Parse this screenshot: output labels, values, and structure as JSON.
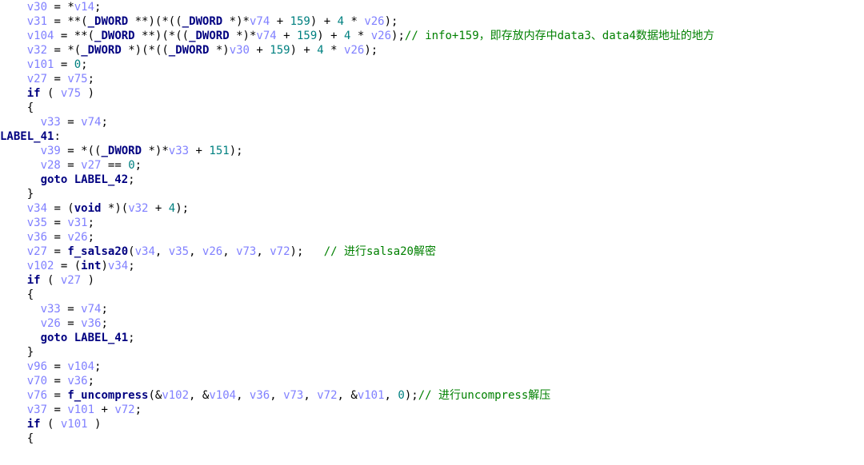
{
  "code": [
    {
      "indent": 2,
      "segs": [
        {
          "t": "var",
          "s": "v30"
        },
        {
          "t": "plain",
          "s": " = "
        },
        {
          "t": "op",
          "s": "*"
        },
        {
          "t": "var",
          "s": "v14"
        },
        {
          "t": "plain",
          "s": ";"
        }
      ]
    },
    {
      "indent": 2,
      "segs": [
        {
          "t": "var",
          "s": "v31"
        },
        {
          "t": "plain",
          "s": " = "
        },
        {
          "t": "op",
          "s": "**"
        },
        {
          "t": "plain",
          "s": "("
        },
        {
          "t": "kw",
          "s": "_DWORD"
        },
        {
          "t": "plain",
          "s": " "
        },
        {
          "t": "op",
          "s": "**"
        },
        {
          "t": "plain",
          "s": ")("
        },
        {
          "t": "op",
          "s": "*"
        },
        {
          "t": "plain",
          "s": "(("
        },
        {
          "t": "kw",
          "s": "_DWORD"
        },
        {
          "t": "plain",
          "s": " "
        },
        {
          "t": "op",
          "s": "*"
        },
        {
          "t": "plain",
          "s": ")"
        },
        {
          "t": "op",
          "s": "*"
        },
        {
          "t": "var",
          "s": "v74"
        },
        {
          "t": "plain",
          "s": " + "
        },
        {
          "t": "num",
          "s": "159"
        },
        {
          "t": "plain",
          "s": ") + "
        },
        {
          "t": "num",
          "s": "4"
        },
        {
          "t": "plain",
          "s": " "
        },
        {
          "t": "op",
          "s": "*"
        },
        {
          "t": "plain",
          "s": " "
        },
        {
          "t": "var",
          "s": "v26"
        },
        {
          "t": "plain",
          "s": ");"
        }
      ]
    },
    {
      "indent": 2,
      "segs": [
        {
          "t": "var",
          "s": "v104"
        },
        {
          "t": "plain",
          "s": " = "
        },
        {
          "t": "op",
          "s": "**"
        },
        {
          "t": "plain",
          "s": "("
        },
        {
          "t": "kw",
          "s": "_DWORD"
        },
        {
          "t": "plain",
          "s": " "
        },
        {
          "t": "op",
          "s": "**"
        },
        {
          "t": "plain",
          "s": ")("
        },
        {
          "t": "op",
          "s": "*"
        },
        {
          "t": "plain",
          "s": "(("
        },
        {
          "t": "kw",
          "s": "_DWORD"
        },
        {
          "t": "plain",
          "s": " "
        },
        {
          "t": "op",
          "s": "*"
        },
        {
          "t": "plain",
          "s": ")"
        },
        {
          "t": "op",
          "s": "*"
        },
        {
          "t": "var",
          "s": "v74"
        },
        {
          "t": "plain",
          "s": " + "
        },
        {
          "t": "num",
          "s": "159"
        },
        {
          "t": "plain",
          "s": ") + "
        },
        {
          "t": "num",
          "s": "4"
        },
        {
          "t": "plain",
          "s": " "
        },
        {
          "t": "op",
          "s": "*"
        },
        {
          "t": "plain",
          "s": " "
        },
        {
          "t": "var",
          "s": "v26"
        },
        {
          "t": "plain",
          "s": ");"
        },
        {
          "t": "cmt",
          "s": "// info+159，即存放内存中data3、data4数据地址的地方"
        }
      ]
    },
    {
      "indent": 2,
      "segs": [
        {
          "t": "var",
          "s": "v32"
        },
        {
          "t": "plain",
          "s": " = "
        },
        {
          "t": "op",
          "s": "*"
        },
        {
          "t": "plain",
          "s": "("
        },
        {
          "t": "kw",
          "s": "_DWORD"
        },
        {
          "t": "plain",
          "s": " "
        },
        {
          "t": "op",
          "s": "*"
        },
        {
          "t": "plain",
          "s": ")("
        },
        {
          "t": "op",
          "s": "*"
        },
        {
          "t": "plain",
          "s": "(("
        },
        {
          "t": "kw",
          "s": "_DWORD"
        },
        {
          "t": "plain",
          "s": " "
        },
        {
          "t": "op",
          "s": "*"
        },
        {
          "t": "plain",
          "s": ")"
        },
        {
          "t": "var",
          "s": "v30"
        },
        {
          "t": "plain",
          "s": " + "
        },
        {
          "t": "num",
          "s": "159"
        },
        {
          "t": "plain",
          "s": ") + "
        },
        {
          "t": "num",
          "s": "4"
        },
        {
          "t": "plain",
          "s": " "
        },
        {
          "t": "op",
          "s": "*"
        },
        {
          "t": "plain",
          "s": " "
        },
        {
          "t": "var",
          "s": "v26"
        },
        {
          "t": "plain",
          "s": ");"
        }
      ]
    },
    {
      "indent": 2,
      "segs": [
        {
          "t": "var",
          "s": "v101"
        },
        {
          "t": "plain",
          "s": " = "
        },
        {
          "t": "num",
          "s": "0"
        },
        {
          "t": "plain",
          "s": ";"
        }
      ]
    },
    {
      "indent": 2,
      "segs": [
        {
          "t": "var",
          "s": "v27"
        },
        {
          "t": "plain",
          "s": " = "
        },
        {
          "t": "var",
          "s": "v75"
        },
        {
          "t": "plain",
          "s": ";"
        }
      ]
    },
    {
      "indent": 2,
      "segs": [
        {
          "t": "kw",
          "s": "if"
        },
        {
          "t": "plain",
          "s": " ( "
        },
        {
          "t": "var",
          "s": "v75"
        },
        {
          "t": "plain",
          "s": " )"
        }
      ]
    },
    {
      "indent": 2,
      "segs": [
        {
          "t": "plain",
          "s": "{"
        }
      ]
    },
    {
      "indent": 3,
      "segs": [
        {
          "t": "var",
          "s": "v33"
        },
        {
          "t": "plain",
          "s": " = "
        },
        {
          "t": "var",
          "s": "v74"
        },
        {
          "t": "plain",
          "s": ";"
        }
      ]
    },
    {
      "indent": 0,
      "segs": [
        {
          "t": "kw",
          "s": "LABEL_41"
        },
        {
          "t": "plain",
          "s": ":"
        }
      ]
    },
    {
      "indent": 3,
      "segs": [
        {
          "t": "var",
          "s": "v39"
        },
        {
          "t": "plain",
          "s": " = "
        },
        {
          "t": "op",
          "s": "*"
        },
        {
          "t": "plain",
          "s": "(("
        },
        {
          "t": "kw",
          "s": "_DWORD"
        },
        {
          "t": "plain",
          "s": " "
        },
        {
          "t": "op",
          "s": "*"
        },
        {
          "t": "plain",
          "s": ")"
        },
        {
          "t": "op",
          "s": "*"
        },
        {
          "t": "var",
          "s": "v33"
        },
        {
          "t": "plain",
          "s": " + "
        },
        {
          "t": "num",
          "s": "151"
        },
        {
          "t": "plain",
          "s": ");"
        }
      ]
    },
    {
      "indent": 3,
      "segs": [
        {
          "t": "var",
          "s": "v28"
        },
        {
          "t": "plain",
          "s": " = "
        },
        {
          "t": "var",
          "s": "v27"
        },
        {
          "t": "plain",
          "s": " == "
        },
        {
          "t": "num",
          "s": "0"
        },
        {
          "t": "plain",
          "s": ";"
        }
      ]
    },
    {
      "indent": 3,
      "segs": [
        {
          "t": "kw",
          "s": "goto"
        },
        {
          "t": "plain",
          "s": " "
        },
        {
          "t": "kw",
          "s": "LABEL_42"
        },
        {
          "t": "plain",
          "s": ";"
        }
      ]
    },
    {
      "indent": 2,
      "segs": [
        {
          "t": "plain",
          "s": "}"
        }
      ]
    },
    {
      "indent": 2,
      "segs": [
        {
          "t": "var",
          "s": "v34"
        },
        {
          "t": "plain",
          "s": " = ("
        },
        {
          "t": "kw",
          "s": "void"
        },
        {
          "t": "plain",
          "s": " "
        },
        {
          "t": "op",
          "s": "*"
        },
        {
          "t": "plain",
          "s": ")("
        },
        {
          "t": "var",
          "s": "v32"
        },
        {
          "t": "plain",
          "s": " + "
        },
        {
          "t": "num",
          "s": "4"
        },
        {
          "t": "plain",
          "s": ");"
        }
      ]
    },
    {
      "indent": 2,
      "segs": [
        {
          "t": "var",
          "s": "v35"
        },
        {
          "t": "plain",
          "s": " = "
        },
        {
          "t": "var",
          "s": "v31"
        },
        {
          "t": "plain",
          "s": ";"
        }
      ]
    },
    {
      "indent": 2,
      "segs": [
        {
          "t": "var",
          "s": "v36"
        },
        {
          "t": "plain",
          "s": " = "
        },
        {
          "t": "var",
          "s": "v26"
        },
        {
          "t": "plain",
          "s": ";"
        }
      ]
    },
    {
      "indent": 2,
      "segs": [
        {
          "t": "var",
          "s": "v27"
        },
        {
          "t": "plain",
          "s": " = "
        },
        {
          "t": "kw",
          "s": "f_salsa20"
        },
        {
          "t": "plain",
          "s": "("
        },
        {
          "t": "var",
          "s": "v34"
        },
        {
          "t": "plain",
          "s": ", "
        },
        {
          "t": "var",
          "s": "v35"
        },
        {
          "t": "plain",
          "s": ", "
        },
        {
          "t": "var",
          "s": "v26"
        },
        {
          "t": "plain",
          "s": ", "
        },
        {
          "t": "var",
          "s": "v73"
        },
        {
          "t": "plain",
          "s": ", "
        },
        {
          "t": "var",
          "s": "v72"
        },
        {
          "t": "plain",
          "s": ");   "
        },
        {
          "t": "cmt",
          "s": "// 进行salsa20解密"
        }
      ]
    },
    {
      "indent": 2,
      "segs": [
        {
          "t": "var",
          "s": "v102"
        },
        {
          "t": "plain",
          "s": " = ("
        },
        {
          "t": "kw",
          "s": "int"
        },
        {
          "t": "plain",
          "s": ")"
        },
        {
          "t": "var",
          "s": "v34"
        },
        {
          "t": "plain",
          "s": ";"
        }
      ]
    },
    {
      "indent": 2,
      "segs": [
        {
          "t": "kw",
          "s": "if"
        },
        {
          "t": "plain",
          "s": " ( "
        },
        {
          "t": "var",
          "s": "v27"
        },
        {
          "t": "plain",
          "s": " )"
        }
      ]
    },
    {
      "indent": 2,
      "segs": [
        {
          "t": "plain",
          "s": "{"
        }
      ]
    },
    {
      "indent": 3,
      "segs": [
        {
          "t": "var",
          "s": "v33"
        },
        {
          "t": "plain",
          "s": " = "
        },
        {
          "t": "var",
          "s": "v74"
        },
        {
          "t": "plain",
          "s": ";"
        }
      ]
    },
    {
      "indent": 3,
      "segs": [
        {
          "t": "var",
          "s": "v26"
        },
        {
          "t": "plain",
          "s": " = "
        },
        {
          "t": "var",
          "s": "v36"
        },
        {
          "t": "plain",
          "s": ";"
        }
      ]
    },
    {
      "indent": 3,
      "segs": [
        {
          "t": "kw",
          "s": "goto"
        },
        {
          "t": "plain",
          "s": " "
        },
        {
          "t": "kw",
          "s": "LABEL_41"
        },
        {
          "t": "plain",
          "s": ";"
        }
      ]
    },
    {
      "indent": 2,
      "segs": [
        {
          "t": "plain",
          "s": "}"
        }
      ]
    },
    {
      "indent": 2,
      "segs": [
        {
          "t": "var",
          "s": "v96"
        },
        {
          "t": "plain",
          "s": " = "
        },
        {
          "t": "var",
          "s": "v104"
        },
        {
          "t": "plain",
          "s": ";"
        }
      ]
    },
    {
      "indent": 2,
      "segs": [
        {
          "t": "var",
          "s": "v70"
        },
        {
          "t": "plain",
          "s": " = "
        },
        {
          "t": "var",
          "s": "v36"
        },
        {
          "t": "plain",
          "s": ";"
        }
      ]
    },
    {
      "indent": 2,
      "segs": [
        {
          "t": "var",
          "s": "v76"
        },
        {
          "t": "plain",
          "s": " = "
        },
        {
          "t": "kw",
          "s": "f_uncompress"
        },
        {
          "t": "plain",
          "s": "(&"
        },
        {
          "t": "var",
          "s": "v102"
        },
        {
          "t": "plain",
          "s": ", &"
        },
        {
          "t": "var",
          "s": "v104"
        },
        {
          "t": "plain",
          "s": ", "
        },
        {
          "t": "var",
          "s": "v36"
        },
        {
          "t": "plain",
          "s": ", "
        },
        {
          "t": "var",
          "s": "v73"
        },
        {
          "t": "plain",
          "s": ", "
        },
        {
          "t": "var",
          "s": "v72"
        },
        {
          "t": "plain",
          "s": ", &"
        },
        {
          "t": "var",
          "s": "v101"
        },
        {
          "t": "plain",
          "s": ", "
        },
        {
          "t": "num",
          "s": "0"
        },
        {
          "t": "plain",
          "s": ");"
        },
        {
          "t": "cmt",
          "s": "// 进行uncompress解压"
        }
      ]
    },
    {
      "indent": 2,
      "segs": [
        {
          "t": "var",
          "s": "v37"
        },
        {
          "t": "plain",
          "s": " = "
        },
        {
          "t": "var",
          "s": "v101"
        },
        {
          "t": "plain",
          "s": " + "
        },
        {
          "t": "var",
          "s": "v72"
        },
        {
          "t": "plain",
          "s": ";"
        }
      ]
    },
    {
      "indent": 2,
      "segs": [
        {
          "t": "kw",
          "s": "if"
        },
        {
          "t": "plain",
          "s": " ( "
        },
        {
          "t": "var",
          "s": "v101"
        },
        {
          "t": "plain",
          "s": " )"
        }
      ]
    },
    {
      "indent": 2,
      "segs": [
        {
          "t": "plain",
          "s": "{"
        }
      ]
    }
  ]
}
